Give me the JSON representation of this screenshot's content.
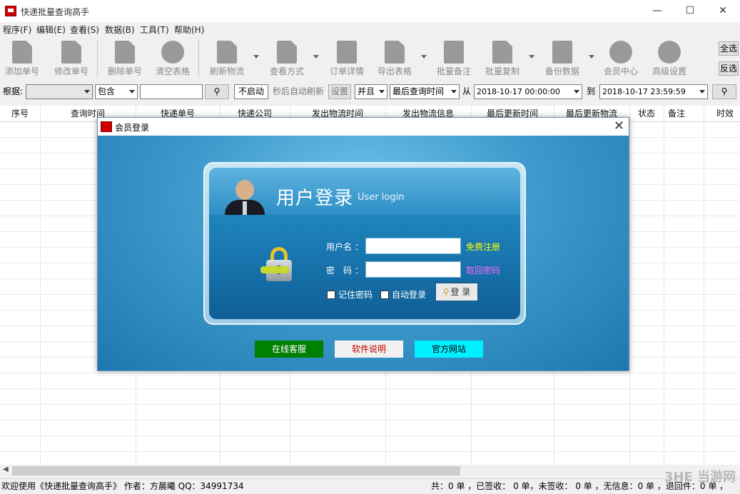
{
  "window": {
    "title": "快递批量查询高手"
  },
  "menu": [
    "程序(F)",
    "编辑(E)",
    "查看(S)",
    "数据(B)",
    "工具(T)",
    "帮助(H)"
  ],
  "toolbar": {
    "buttons": [
      "添加单号",
      "修改单号",
      "删除单号",
      "清空表格",
      "刷新物流",
      "查看方式",
      "订单详情",
      "导出表格",
      "批量备注",
      "批量复制",
      "备份数据",
      "会员中心",
      "高级设置"
    ],
    "select_all": "全选",
    "invert": "反选"
  },
  "filter": {
    "label": "根据:",
    "field_value": "",
    "op_value": "包含",
    "search_value": "",
    "refresh_value": "不启动",
    "refresh_label": "秒后自动刷新",
    "settings": "设置",
    "logic": "并且",
    "time_field": "最后查询时间",
    "from_label": "从",
    "from_date": "2018-10-17 00:00:00",
    "to_label": "到",
    "to_date": "2018-10-17 23:59:59"
  },
  "table": {
    "columns": [
      "序号",
      "查询时间",
      "快递单号",
      "快递公司",
      "发出物流时间",
      "发出物流信息",
      "最后更新时间",
      "最后更新物流",
      "状态",
      "备注",
      "时效"
    ]
  },
  "status": {
    "left": "欢迎使用《快递批量查询高手》 作者：方晨曦 QQ：34991734",
    "right": "共：0 单 ，已签收： 0 单，未签收： 0 单 ，无信息：0 单 ，退回件：0 单 ，"
  },
  "dialog": {
    "title": "会员登录",
    "heading_cn": "用户登录",
    "heading_en": "User login",
    "username_label": "用户名 ：",
    "password_label": "密　码 ：",
    "username_value": "",
    "password_value": "",
    "register_link": "免费注册",
    "recover_link": "取回密码",
    "remember": "记住密码",
    "auto_login": "自动登录",
    "login_button": "登 录",
    "buttons": [
      "在线客服",
      "软件说明",
      "官方网站"
    ]
  },
  "colors": {
    "service_btn": "#008000",
    "manual_btn": "#f0f0f0",
    "site_btn": "#00f0ff",
    "register_link": "#ffff00",
    "recover_link": "#ff66ff"
  },
  "watermark": "3HE 当游网"
}
